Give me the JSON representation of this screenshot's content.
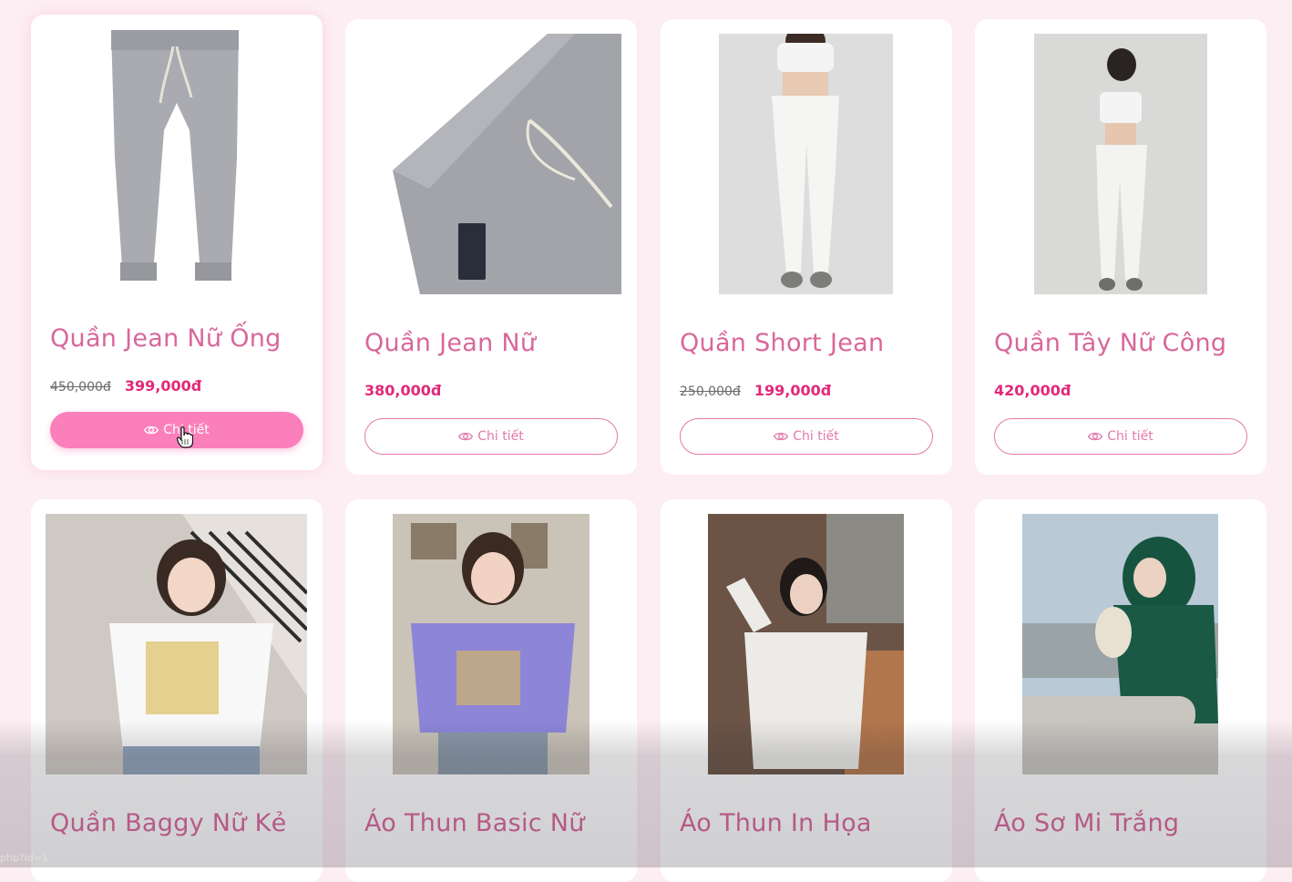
{
  "products": [
    {
      "title": "Quần Jean Nữ Ống",
      "old_price": "450,000đ",
      "price": "399,000đ",
      "button": "Chi tiết",
      "image_icon": "gray-jogger-pants-photo"
    },
    {
      "title": "Quần Jean Nữ",
      "old_price": "",
      "price": "380,000đ",
      "button": "Chi tiết",
      "image_icon": "gray-pants-waist-detail-photo"
    },
    {
      "title": "Quần Short Jean",
      "old_price": "250,000đ",
      "price": "199,000đ",
      "button": "Chi tiết",
      "image_icon": "white-cargo-pants-model-photo"
    },
    {
      "title": "Quần Tây Nữ Công",
      "old_price": "",
      "price": "420,000đ",
      "button": "Chi tiết",
      "image_icon": "white-outfit-model-photo"
    },
    {
      "title": "Quần Baggy Nữ Kẻ",
      "image_icon": "white-graphic-tee-model-photo"
    },
    {
      "title": "Áo Thun Basic Nữ",
      "image_icon": "purple-tee-model-photo"
    },
    {
      "title": "Áo Thun In Họa",
      "image_icon": "white-hoodie-model-photo"
    },
    {
      "title": "Áo Sơ Mi Trắng",
      "image_icon": "green-hoodie-model-photo"
    }
  ],
  "status_url": "php?id=1",
  "colors": {
    "accent": "#fb7fba",
    "title": "#d9679b",
    "price": "#e0297a",
    "background": "#fdeef3"
  }
}
